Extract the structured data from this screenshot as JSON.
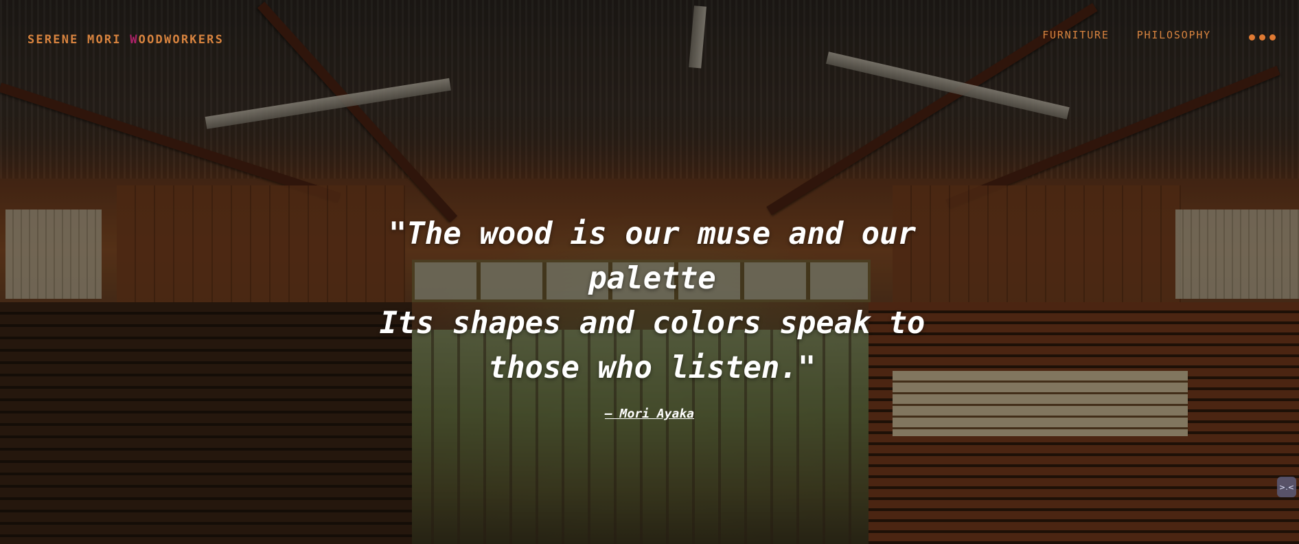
{
  "header": {
    "brand_prefix": "SERENE MORI ",
    "brand_highlight": "W",
    "brand_suffix": "OODWORKERS",
    "nav_items": [
      {
        "label": "FURNITURE"
      },
      {
        "label": "PHILOSOPHY"
      }
    ],
    "more_icon": "ellipsis-icon"
  },
  "hero": {
    "quote_lines": [
      "\"The wood is our muse and our",
      "palette",
      "Its shapes and colors speak to",
      "those who listen.\""
    ],
    "author": "— Mori Ayaka"
  },
  "widgets": {
    "collapse_icon_text": ">.<"
  },
  "colors": {
    "accent": "#d9843f",
    "highlight": "#b0226a",
    "quote_text": "#ffffff"
  }
}
